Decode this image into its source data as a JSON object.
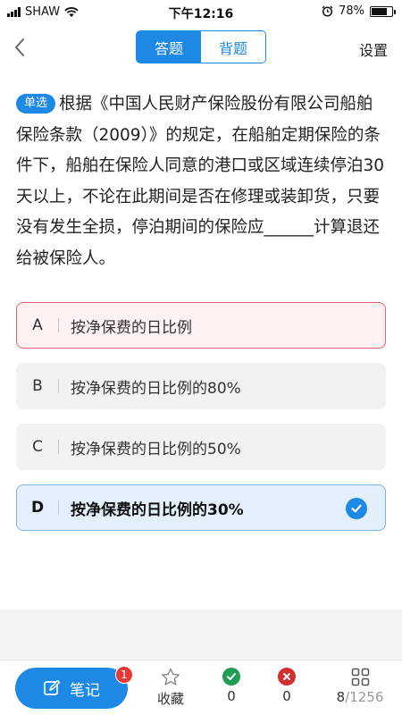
{
  "status_bar": {
    "carrier": "SHAW",
    "time": "下午12:16",
    "battery": "78%",
    "battery_level": 0.78
  },
  "nav": {
    "tabs": [
      {
        "label": "答题",
        "active": true
      },
      {
        "label": "背题",
        "active": false
      }
    ],
    "settings_label": "设置"
  },
  "question": {
    "type_badge": "单选",
    "text": "根据《中国人民财产保险股份有限公司船舶保险条款（2009）》的规定，在船舶定期保险的条件下，船舶在保险人同意的港口或区域连续停泊30天以上，不论在此期间是否在修理或装卸货，只要没有发生全损，停泊期间的保险应______计算退还给被保险人。"
  },
  "options": [
    {
      "letter": "A",
      "text": "按净保费的日比例",
      "state": "wrong"
    },
    {
      "letter": "B",
      "text": "按净保费的日比例的80%",
      "state": "normal"
    },
    {
      "letter": "C",
      "text": "按净保费的日比例的50%",
      "state": "normal"
    },
    {
      "letter": "D",
      "text": "按净保费的日比例的30%",
      "state": "selected"
    }
  ],
  "bottom_bar": {
    "note_label": "笔记",
    "note_badge": "1",
    "favorite_label": "收藏",
    "correct_count": "0",
    "wrong_count": "0",
    "progress_current": "8",
    "progress_total": "/1256"
  },
  "colors": {
    "accent": "#1e88e5",
    "wrong": "#e06471",
    "correct": "#1f9d55",
    "badge": "#e53935"
  }
}
